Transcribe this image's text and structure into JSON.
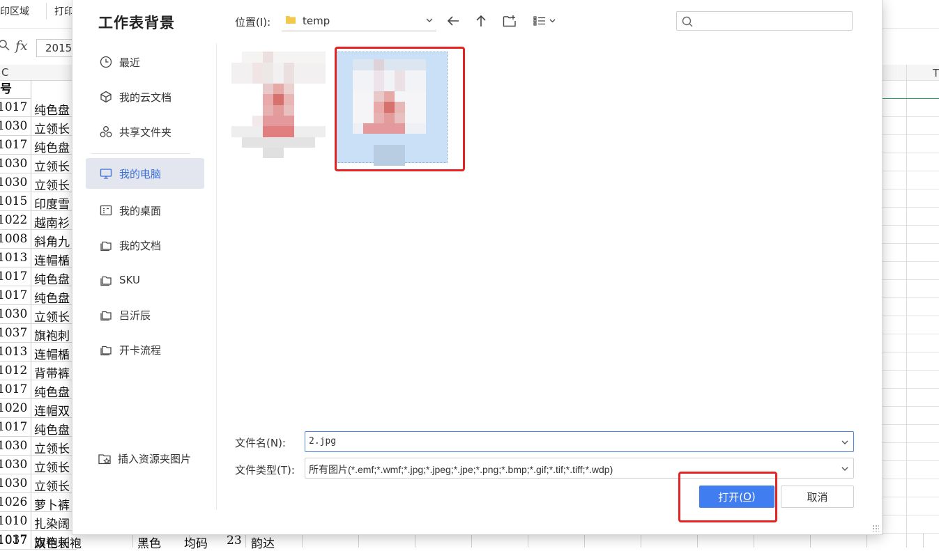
{
  "spreadsheet": {
    "ribbon": {
      "print_area_label": "印区域",
      "print_label": "打印"
    },
    "formula_bar": {
      "fx": "fx",
      "cell_value": "2015."
    },
    "column_headers": [
      "C",
      "T"
    ],
    "header_cell": "号",
    "rows": [
      {
        "a": "1017",
        "b": "纯色盘"
      },
      {
        "a": "1030",
        "b": "立领长"
      },
      {
        "a": "1017",
        "b": "纯色盘"
      },
      {
        "a": "1030",
        "b": "立领长"
      },
      {
        "a": "1030",
        "b": "立领长"
      },
      {
        "a": "1015",
        "b": "印度雪"
      },
      {
        "a": "1022",
        "b": "越南衫"
      },
      {
        "a": "1008",
        "b": "斜角九"
      },
      {
        "a": "1013",
        "b": "连帽楯"
      },
      {
        "a": "1017",
        "b": "纯色盘"
      },
      {
        "a": "1017",
        "b": "纯色盘"
      },
      {
        "a": "1030",
        "b": "立领长"
      },
      {
        "a": "1037",
        "b": "旗袍刺"
      },
      {
        "a": "1013",
        "b": "连帽楯"
      },
      {
        "a": "1012",
        "b": "背带裤"
      },
      {
        "a": "1017",
        "b": "纯色盘"
      },
      {
        "a": "1020",
        "b": "连帽双"
      },
      {
        "a": "1017",
        "b": "纯色盘"
      },
      {
        "a": "1030",
        "b": "立领长"
      },
      {
        "a": "1030",
        "b": "立领长"
      },
      {
        "a": "1030",
        "b": "立领长"
      },
      {
        "a": "1026",
        "b": "萝卜裤"
      },
      {
        "a": "1010",
        "b": "扎染阔"
      },
      {
        "a": "1037",
        "b": "旗袍刺"
      }
    ],
    "last_row": {
      "a": "1017",
      "b": "双色长袍",
      "c": "黑色",
      "d": "均码",
      "e": "23",
      "f": "韵达"
    }
  },
  "dialog": {
    "title": "工作表背景",
    "sidebar": {
      "items": [
        {
          "label": "最近",
          "icon": "clock-icon"
        },
        {
          "label": "我的云文档",
          "icon": "cube-icon"
        },
        {
          "label": "共享文件夹",
          "icon": "share-icon"
        },
        {
          "label": "我的电脑",
          "icon": "computer-icon",
          "active": true
        },
        {
          "label": "我的桌面",
          "icon": "desktop-icon"
        },
        {
          "label": "我的文档",
          "icon": "folder-icon"
        },
        {
          "label": "SKU",
          "icon": "folder-icon"
        },
        {
          "label": "吕沂辰",
          "icon": "folder-icon"
        },
        {
          "label": "开卡流程",
          "icon": "folder-icon"
        }
      ],
      "insert_resource": "插入资源夹图片"
    },
    "toolbar": {
      "location_label": "位置(I):",
      "location_value": "temp",
      "search_placeholder": ""
    },
    "file_name_label": "文件名(N):",
    "file_name_value": "2.jpg",
    "file_type_label": "文件类型(T):",
    "file_type_value": "所有图片(*.emf;*.wmf;*.jpg;*.jpeg;*.jpe;*.png;*.bmp;*.gif;*.tif;*.tiff;*.wdp)",
    "open_button": {
      "text": "打开(",
      "key": "O",
      "close": ")"
    },
    "cancel_button": "取消",
    "colors": {
      "accent": "#3f7df0",
      "highlight": "#e52323",
      "selection": "#c9e0f7"
    }
  }
}
